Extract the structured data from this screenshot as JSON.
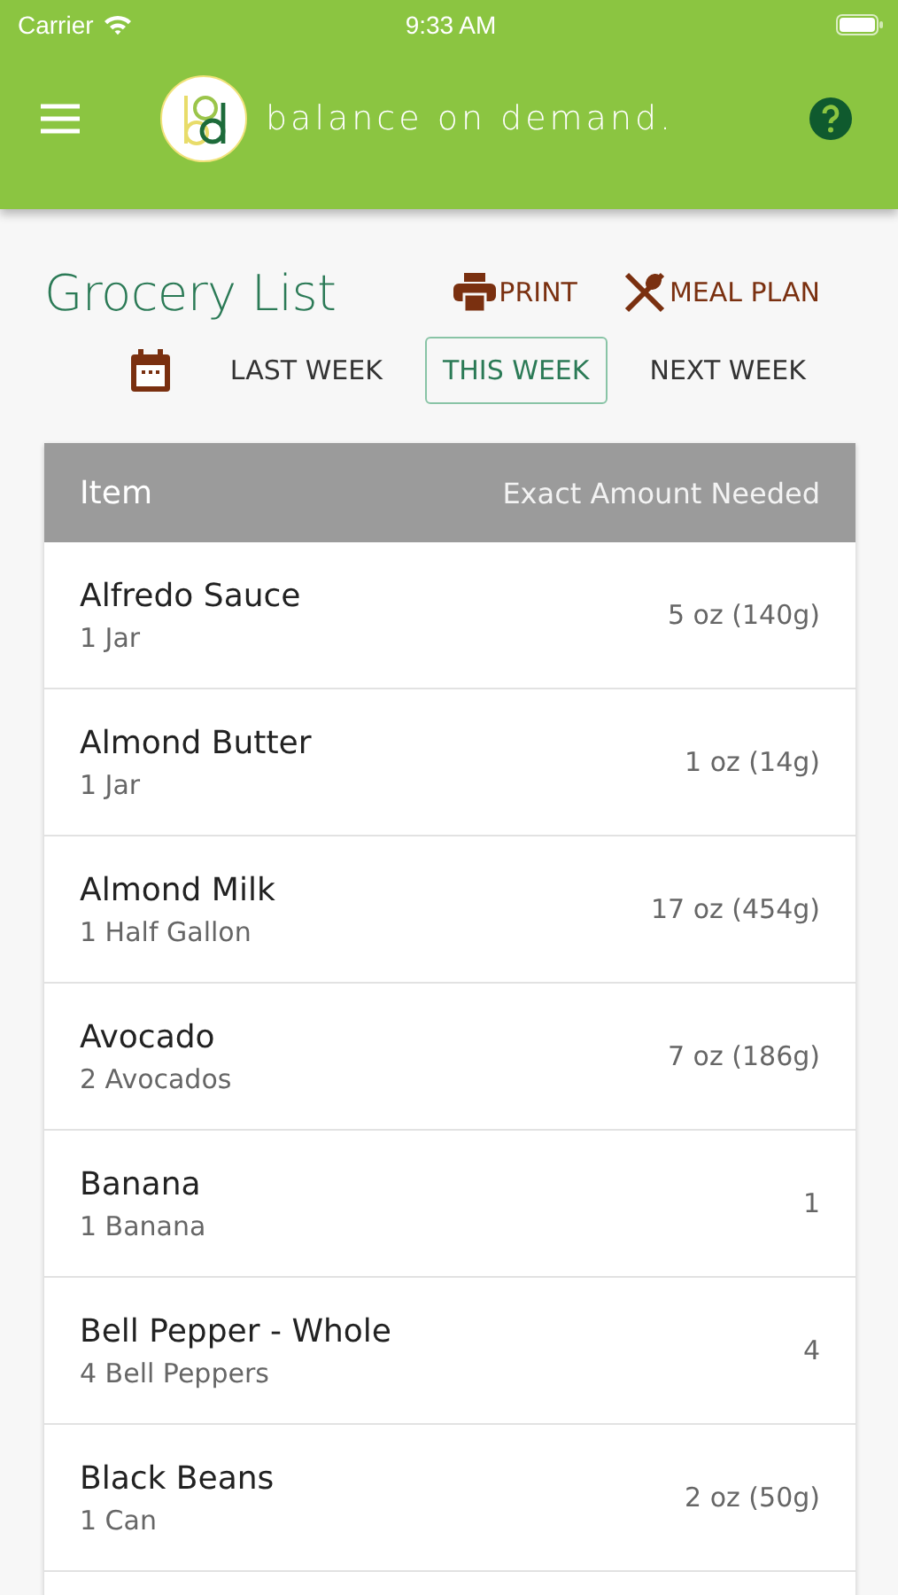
{
  "status_bar": {
    "carrier": "Carrier",
    "time": "9:33 AM"
  },
  "header": {
    "brand": "balance on demand."
  },
  "page": {
    "title": "Grocery List",
    "actions": [
      {
        "kind": "print",
        "label": "PRINT"
      },
      {
        "kind": "meal",
        "label": "MEAL PLAN"
      }
    ]
  },
  "weeks": [
    {
      "label": "LAST WEEK",
      "selected": false
    },
    {
      "label": "THIS WEEK",
      "selected": true
    },
    {
      "label": "NEXT WEEK",
      "selected": false
    }
  ],
  "table": {
    "columns": [
      "Item",
      "Exact Amount Needed"
    ],
    "rows": [
      {
        "name": "Alfredo Sauce",
        "unit": "1 Jar",
        "amount": "5 oz (140g)"
      },
      {
        "name": "Almond Butter",
        "unit": "1 Jar",
        "amount": "1 oz (14g)"
      },
      {
        "name": "Almond Milk",
        "unit": "1 Half Gallon",
        "amount": "17 oz (454g)"
      },
      {
        "name": "Avocado",
        "unit": "2 Avocados",
        "amount": "7 oz (186g)"
      },
      {
        "name": "Banana",
        "unit": "1 Banana",
        "amount": "1"
      },
      {
        "name": "Bell Pepper - Whole",
        "unit": "4 Bell Peppers",
        "amount": "4"
      },
      {
        "name": "Black Beans",
        "unit": "1 Can",
        "amount": "2 oz (50g)"
      }
    ]
  }
}
